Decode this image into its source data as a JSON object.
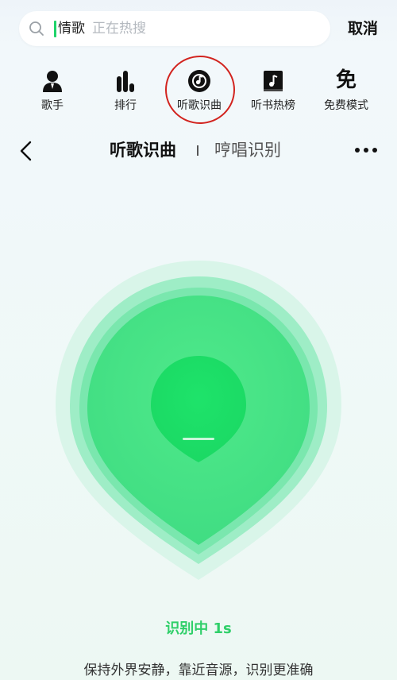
{
  "search": {
    "query": "情歌",
    "placeholder": "正在热搜",
    "cancel_label": "取消"
  },
  "quick_nav": [
    {
      "label": "歌手",
      "icon": "singer-icon"
    },
    {
      "label": "排行",
      "icon": "chart-bars-icon"
    },
    {
      "label": "听歌识曲",
      "icon": "song-recognition-icon",
      "highlighted": true
    },
    {
      "label": "听书热榜",
      "icon": "audiobook-icon"
    },
    {
      "label": "免费模式",
      "icon": "free-mode-icon",
      "glyph": "免"
    }
  ],
  "header": {
    "tab_active": "听歌识曲",
    "tab_inactive": "哼唱识别"
  },
  "recognition": {
    "status": "识别中 1s",
    "hint": "保持外界安静，靠近音源，识别更准确"
  },
  "colors": {
    "accent": "#2fcf69",
    "highlight_ring": "#d2231e"
  }
}
